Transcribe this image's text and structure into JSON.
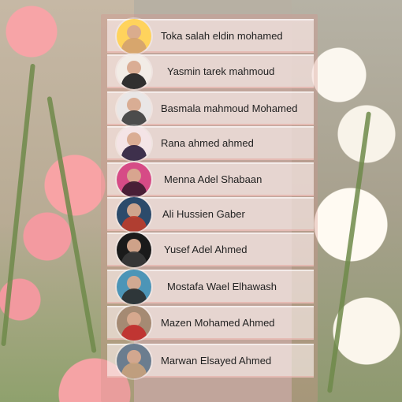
{
  "people": [
    {
      "name": "Toka salah eldin mohamed",
      "avatar": {
        "bg": "#ffd35c",
        "accent": "#d3a16f"
      }
    },
    {
      "name": "Yasmin tarek mahmoud",
      "avatar": {
        "bg": "#f2ece6",
        "accent": "#1b1b1b"
      }
    },
    {
      "name": "Basmala mahmoud Mohamed",
      "avatar": {
        "bg": "#e9e6e6",
        "accent": "#3b3b3b"
      }
    },
    {
      "name": "Rana ahmed ahmed",
      "avatar": {
        "bg": "#f4e4e6",
        "accent": "#2a1c3b"
      }
    },
    {
      "name": "Menna Adel Shabaan",
      "avatar": {
        "bg": "#d64b86",
        "accent": "#3a1b2d"
      }
    },
    {
      "name": "Ali Hussien Gaber",
      "avatar": {
        "bg": "#2c4b6b",
        "accent": "#bf3d2b"
      }
    },
    {
      "name": "Yusef Adel Ahmed",
      "avatar": {
        "bg": "#1a1a1a",
        "accent": "#3a3a3a"
      }
    },
    {
      "name": "Mostafa Wael Elhawash",
      "avatar": {
        "bg": "#4c95b7",
        "accent": "#2b2b2b"
      }
    },
    {
      "name": "Mazen Mohamed Ahmed",
      "avatar": {
        "bg": "#a58a73",
        "accent": "#c32b2b"
      }
    },
    {
      "name": "Marwan Elsayed Ahmed",
      "avatar": {
        "bg": "#6b7d8f",
        "accent": "#c9a27c"
      }
    }
  ]
}
